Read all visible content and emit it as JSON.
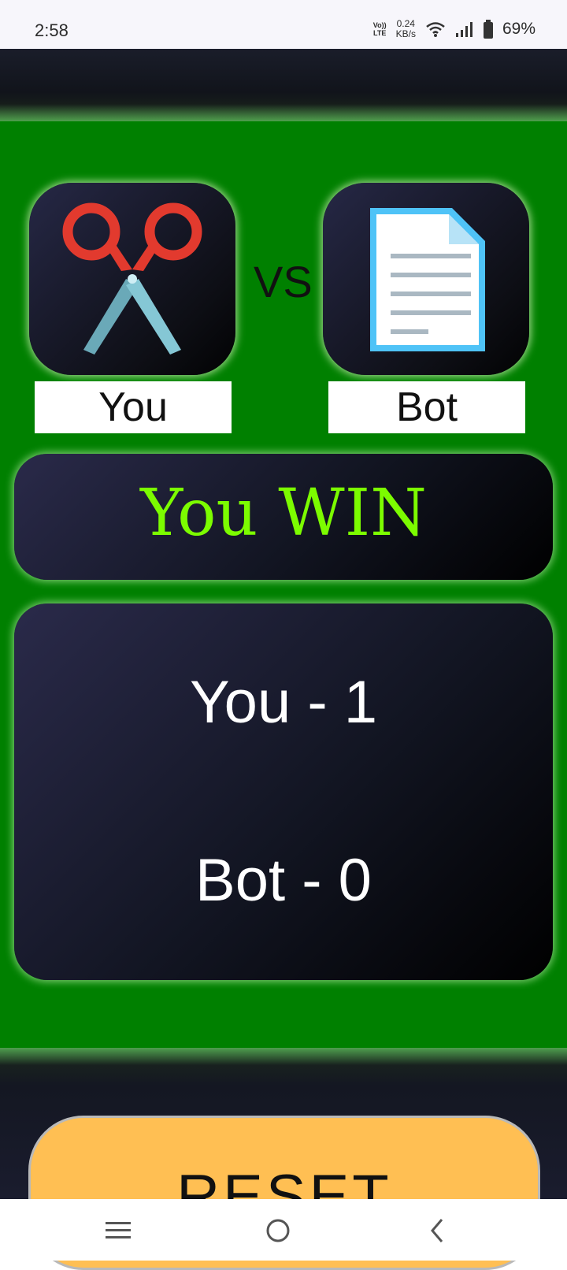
{
  "status_bar": {
    "time": "2:58",
    "network_top": "Vo))",
    "network_bottom": "LTE",
    "speed_value": "0.24",
    "speed_unit": "KB/s",
    "battery": "69%"
  },
  "game": {
    "player_choice_icon": "scissors-icon",
    "bot_choice_icon": "paper-document-icon",
    "vs_label": "VS",
    "player_label": "You",
    "bot_label": "Bot",
    "result": "You WIN",
    "player_score": "You - 1",
    "bot_score": "Bot - 0",
    "reset_label": "RESET"
  },
  "nav": {
    "menu_icon": "menu-icon",
    "home_icon": "home-circle-icon",
    "back_icon": "back-chevron-icon"
  },
  "colors": {
    "game_background": "#008000",
    "result_text": "#7cfc00",
    "reset_button": "#ffbf53"
  }
}
